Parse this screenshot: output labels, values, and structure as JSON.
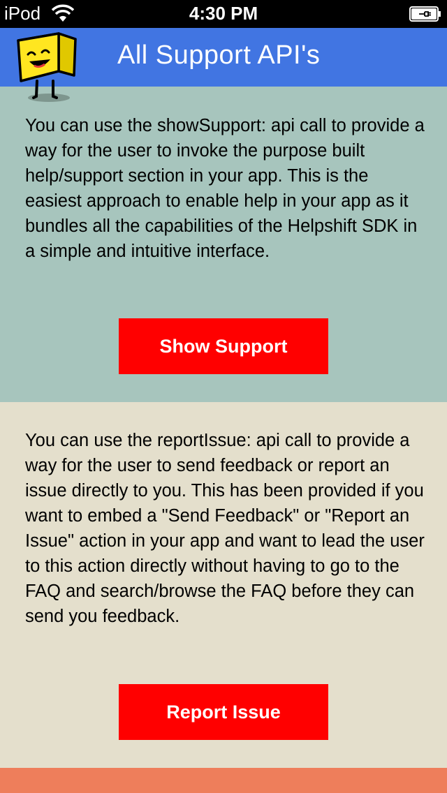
{
  "status_bar": {
    "carrier": "iPod",
    "time": "4:30 PM",
    "wifi_icon": "wifi-icon",
    "battery_icon": "battery-charging-icon"
  },
  "nav": {
    "title": "All Support API's",
    "mascot_icon": "yellow-box-mascot-icon",
    "color": "#4175e2"
  },
  "support_section": {
    "text": "You can use the showSupport: api call to provide a way for the user to invoke the purpose built help/support section in your app. This is the easiest approach to enable help in your app as it bundles all the capabilities of the Helpshift SDK in a simple and intuitive interface.",
    "button_label": "Show Support",
    "background": "#a7c5bd"
  },
  "report_section": {
    "text": "You can use the reportIssue: api call to provide a way for the user to send feedback or report an issue directly to you. This has been provided if you want to embed a \"Send Feedback\" or \"Report an Issue\" action in your app and want to lead the user to this action directly without having to go to the FAQ and search/browse the FAQ before they can send you feedback.",
    "button_label": "Report Issue",
    "background": "#e4dfcc"
  },
  "colors": {
    "button": "#ff0000",
    "bottom_section": "#ee7e5b"
  }
}
